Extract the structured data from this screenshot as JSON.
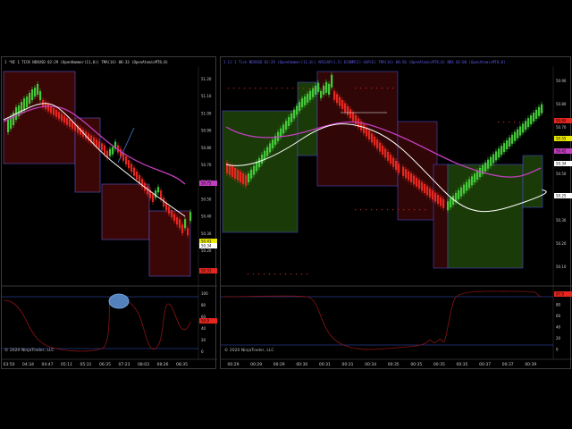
{
  "left_chart": {
    "header": "1 ^NI 1 TICK NDXUSD 02:29 (OpenHammer(11,0)) TMA(14) 08:33 (OpenAtomicMT8,0)",
    "copyright": "© 2020 NinjaTrader, LLC",
    "price_labels": [
      "51.20",
      "51.10",
      "51.00",
      "50.90",
      "50.80",
      "50.70",
      "50.60",
      "50.50",
      "50.40",
      "50.30",
      "50.20"
    ],
    "tags": [
      "50.75",
      "50.41",
      "50.34",
      "50.31"
    ],
    "osc_labels": [
      "100",
      "80",
      "60",
      "40",
      "20",
      "0"
    ],
    "osc_tag": "59.9",
    "time_labels": [
      "03:50",
      "04:34",
      "04:47",
      "05:11",
      "05:31",
      "06:35",
      "07:23",
      "08:03",
      "08:26",
      "08:35"
    ],
    "colors": {
      "up": "#43c83a",
      "down": "#e6261f",
      "ema_slow": "#c23fbf",
      "ema_fast": "#ffffff",
      "zone_red": "#3a0606",
      "zone_border": "#5a5ad0",
      "osc": "#8b1414",
      "circle": "#5b8fd0"
    }
  },
  "right_chart": {
    "header": "1 CJ 1 Tick NDXUSD 02:29 (OpenHammer(11,0)) ARCGAP(1.5) ECHNM(2) GAP(E) TMA(14) 08:50 (OpenAtomicMT8,0) NDX 02:00 (OpenAtomicMT8,0)",
    "copyright": "© 2020 NinjaTrader, LLC",
    "price_labels": [
      "50.90",
      "50.80",
      "50.70",
      "50.60",
      "50.50",
      "50.40",
      "50.30",
      "50.20",
      "50.10"
    ],
    "tags": [
      "50.60",
      "50.55",
      "50.42",
      "50.34",
      "50.25"
    ],
    "osc_labels": [
      "100",
      "80",
      "60",
      "40",
      "20",
      "0"
    ],
    "osc_tag": "97.9",
    "time_labels": [
      "00:29",
      "00:29",
      "00:29",
      "00:30",
      "00:31",
      "00:31",
      "00:34",
      "00:35",
      "00:35",
      "00:35",
      "00:35",
      "00:37",
      "00:37",
      "00:39"
    ],
    "colors": {
      "up": "#43c83a",
      "down": "#e6261f",
      "ema_slow": "#c23fbf",
      "ema_fast": "#ffffff",
      "zone_green": "#1a3a07",
      "zone_red": "#300606",
      "zone_border": "#4a4ac8",
      "osc": "#8b1414",
      "dots": "#c02020"
    }
  }
}
